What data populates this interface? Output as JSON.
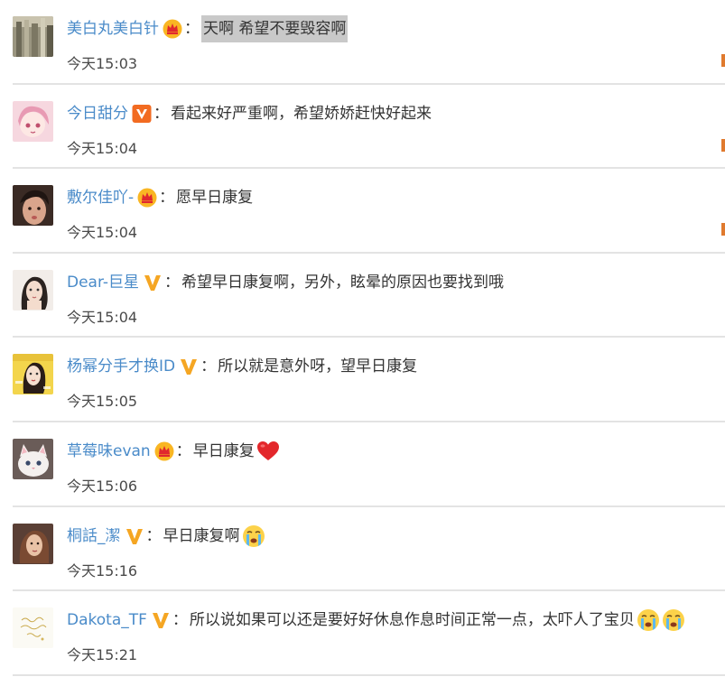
{
  "comments": [
    {
      "username": "美白丸美白针",
      "badge": "crown",
      "text": "天啊 希望不要毁容啊",
      "time": "今天15:03",
      "highlight": true,
      "emojis": [],
      "edge_mark": true,
      "avatar": "photo-book"
    },
    {
      "username": "今日甜分",
      "badge": "orange-v",
      "text": "看起来好严重啊，希望娇娇赶快好起来",
      "time": "今天15:04",
      "highlight": false,
      "emojis": [],
      "edge_mark": true,
      "avatar": "anime-pink"
    },
    {
      "username": "敷尔佳吖-",
      "badge": "crown",
      "text": "愿早日康复",
      "time": "今天15:04",
      "highlight": false,
      "emojis": [],
      "edge_mark": true,
      "avatar": "selfie"
    },
    {
      "username": "Dear-巨星",
      "badge": "yellow-v",
      "text": "希望早日康复啊，另外，眩晕的原因也要找到哦",
      "time": "今天15:04",
      "highlight": false,
      "emojis": [],
      "edge_mark": false,
      "avatar": "sketch-girl"
    },
    {
      "username": "杨幂分手才换ID",
      "badge": "yellow-v",
      "text": "所以就是意外呀，望早日康复",
      "time": "今天15:05",
      "highlight": false,
      "emojis": [],
      "edge_mark": false,
      "avatar": "yellow-poster"
    },
    {
      "username": "草莓味evan",
      "badge": "crown",
      "text": "早日康复",
      "time": "今天15:06",
      "highlight": false,
      "emojis": [
        "heart"
      ],
      "edge_mark": false,
      "avatar": "white-cat"
    },
    {
      "username": "桐話_潔",
      "badge": "yellow-v",
      "text": "早日康复啊",
      "time": "今天15:16",
      "highlight": false,
      "emojis": [
        "crying-face"
      ],
      "edge_mark": false,
      "avatar": "portrait"
    },
    {
      "username": "Dakota_TF",
      "badge": "yellow-v",
      "text": "所以说如果可以还是要好好休息作息时间正常一点，太吓人了宝贝",
      "time": "今天15:21",
      "highlight": false,
      "emojis": [
        "crying-face",
        "crying-face"
      ],
      "edge_mark": false,
      "avatar": "birthday-card"
    }
  ],
  "separator": "：",
  "colors": {
    "username": "#4a8bc9",
    "text": "#333333",
    "time": "#4a4a4a",
    "divider": "#e3e3e3",
    "highlight": "#c9c9c9"
  }
}
